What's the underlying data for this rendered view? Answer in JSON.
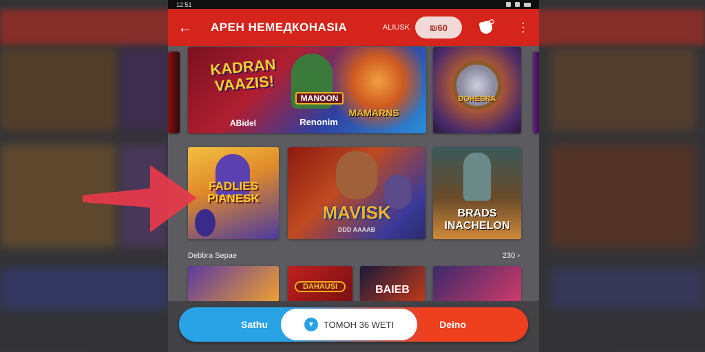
{
  "status_bar": {
    "time": "12:51"
  },
  "app_bar": {
    "title": "АРЕН НЕМЕДКОНАSIА",
    "coins_label": "ALIUSK",
    "pill_text": "₪60"
  },
  "featured": [
    {
      "title": "KADRAN VAAZIS!",
      "subtitle": "ABidel"
    },
    {
      "title": "MANOON",
      "subtitle": "Renonim",
      "badge": "MAMARNS"
    },
    {
      "title": "DOHESRA",
      "subtitle": ""
    }
  ],
  "grid": [
    {
      "title": "FADLIES PIANESK"
    },
    {
      "title": "MAVISK",
      "subtitle": "DDD AAAAB"
    },
    {
      "title": "BRADS INACHELON"
    }
  ],
  "section": {
    "title": "Debbra Sepae",
    "see_all": "230"
  },
  "row": [
    {
      "title": ""
    },
    {
      "title": "DAHAUSI"
    },
    {
      "title": "BAIEB"
    },
    {
      "title": ""
    }
  ],
  "bottom_bar": {
    "left_label": "Sathu",
    "center_label": "TOMOH 36 WETI",
    "right_label": "Deino"
  },
  "colors": {
    "brand": "#d4241b",
    "accent_blue": "#2aa2e6",
    "accent_orange": "#ee3f1f"
  }
}
